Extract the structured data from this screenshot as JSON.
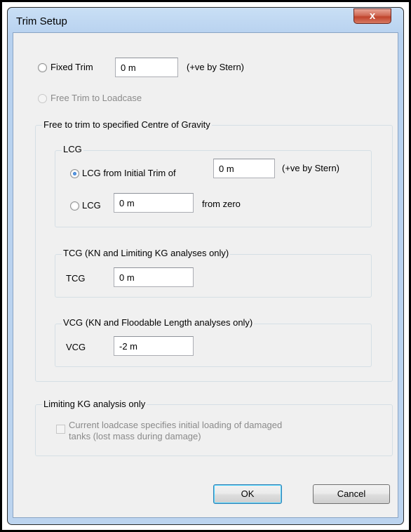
{
  "window": {
    "title": "Trim Setup",
    "close_label": "x"
  },
  "fixed_trim": {
    "label": "Fixed Trim",
    "value": "0 m",
    "note": "(+ve by Stern)"
  },
  "free_trim": {
    "label": "Free Trim to Loadcase"
  },
  "cog_group": {
    "title": "Free to trim to specified Centre of Gravity"
  },
  "lcg_group": {
    "title": "LCG",
    "from_initial_trim": {
      "label": "LCG from Initial Trim of",
      "value": "0 m",
      "note": "(+ve by Stern)"
    },
    "from_zero": {
      "label": "LCG",
      "value": "0 m",
      "note": "from zero"
    }
  },
  "tcg_group": {
    "title": "TCG (KN and Limiting KG analyses only)",
    "label": "TCG",
    "value": "0 m"
  },
  "vcg_group": {
    "title": "VCG (KN and Floodable Length analyses only)",
    "label": "VCG",
    "value": "-2 m"
  },
  "limiting_kg": {
    "title": "Limiting KG analysis only",
    "checkbox_line1": "Current loadcase specifies initial loading of damaged",
    "checkbox_line2": "tanks (lost mass during damage)"
  },
  "buttons": {
    "ok": "OK",
    "cancel": "Cancel"
  }
}
